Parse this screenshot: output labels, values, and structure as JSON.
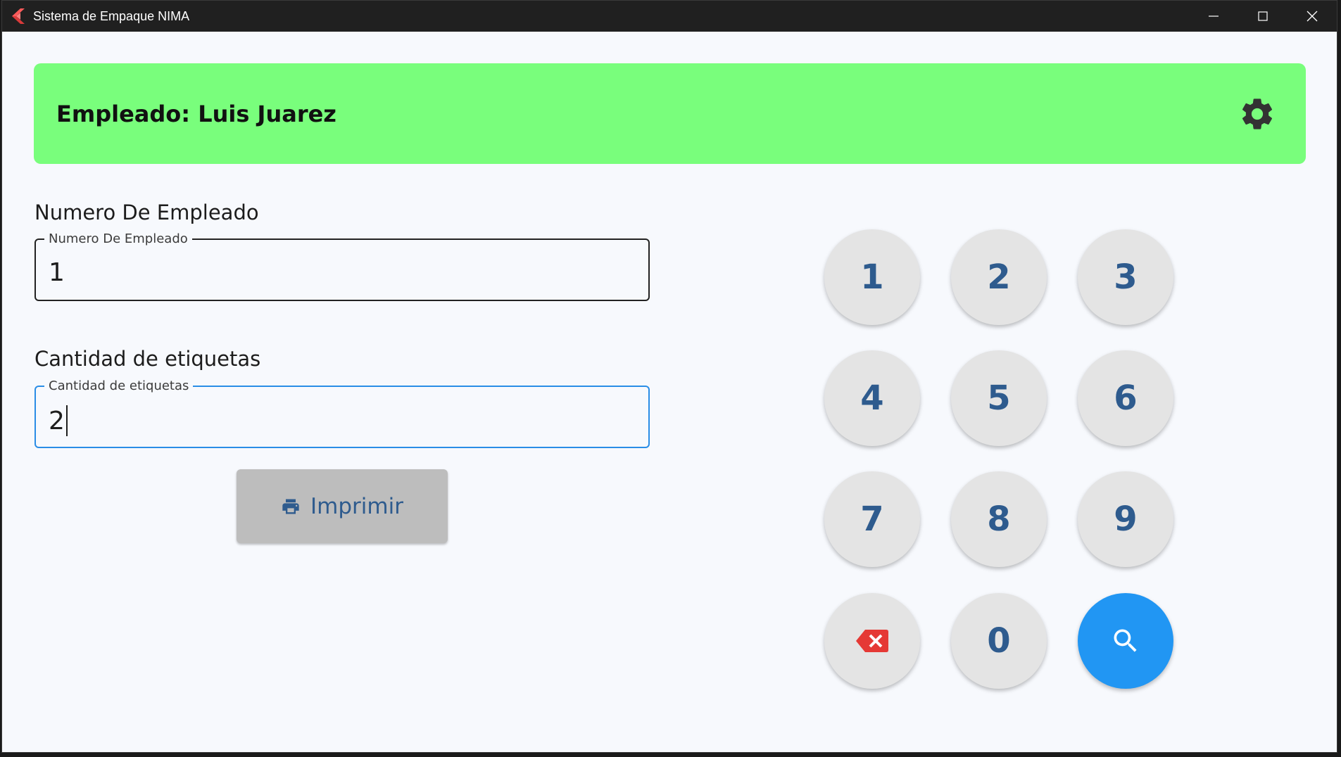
{
  "window": {
    "title": "Sistema de Empaque NIMA",
    "icon": "flutter-logo-icon"
  },
  "header": {
    "employee_title": "Empleado: Luis Juarez",
    "background_color": "#79fe7c",
    "settings_icon": "gear-icon"
  },
  "employee_number": {
    "section_label": "Numero De Empleado",
    "field_label": "Numero De Empleado",
    "value": "1"
  },
  "label_quantity": {
    "section_label": "Cantidad de etiquetas",
    "field_label": "Cantidad de etiquetas",
    "value": "2"
  },
  "print_button": {
    "label": "Imprimir",
    "icon": "printer-icon"
  },
  "keypad": {
    "digits": [
      "1",
      "2",
      "3",
      "4",
      "5",
      "6",
      "7",
      "8",
      "9"
    ],
    "zero": "0",
    "backspace_icon": "backspace-icon",
    "search_icon": "search-icon",
    "key_color": "#e4e4e4",
    "digit_color": "#2e5b8e",
    "search_color": "#2196f3",
    "backspace_color": "#e53935"
  }
}
